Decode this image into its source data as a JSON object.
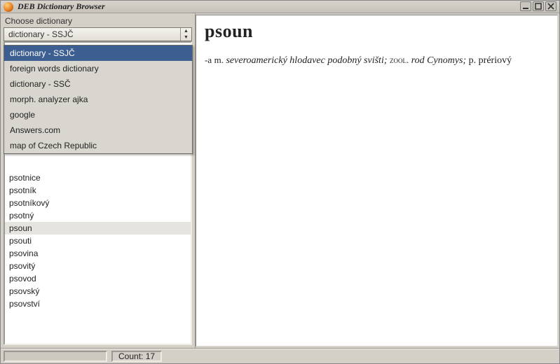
{
  "window": {
    "title": "DEB Dictionary Browser"
  },
  "leftpanel": {
    "choose_label": "Choose dictionary",
    "combo_value": "dictionary - SSJČ",
    "dropdown": {
      "selected_index": 0,
      "items": [
        "dictionary - SSJČ",
        "foreign words dictionary",
        "dictionary - SSČ",
        "morph. analyzer ajka",
        "google",
        "Answers.com",
        "map of Czech Republic"
      ]
    },
    "wordlist": {
      "selected_index": 4,
      "items": [
        "psotnice",
        "psotník",
        "psotníkový",
        "psotný",
        "psoun",
        "psouti",
        "psovina",
        "psovitý",
        "psovod",
        "psovský",
        "psovství"
      ]
    }
  },
  "entry": {
    "headword": "psoun",
    "gram_prefix": "-a",
    "gram_gender": "m.",
    "defn_italic1": "severoamerický hlodavec podobný svišti;",
    "label_zool": "zool.",
    "defn_italic2": "rod Cynomys;",
    "abbrev_p": "p.",
    "tail": "prériový"
  },
  "statusbar": {
    "count_label": "Count:",
    "count_value": "17"
  }
}
